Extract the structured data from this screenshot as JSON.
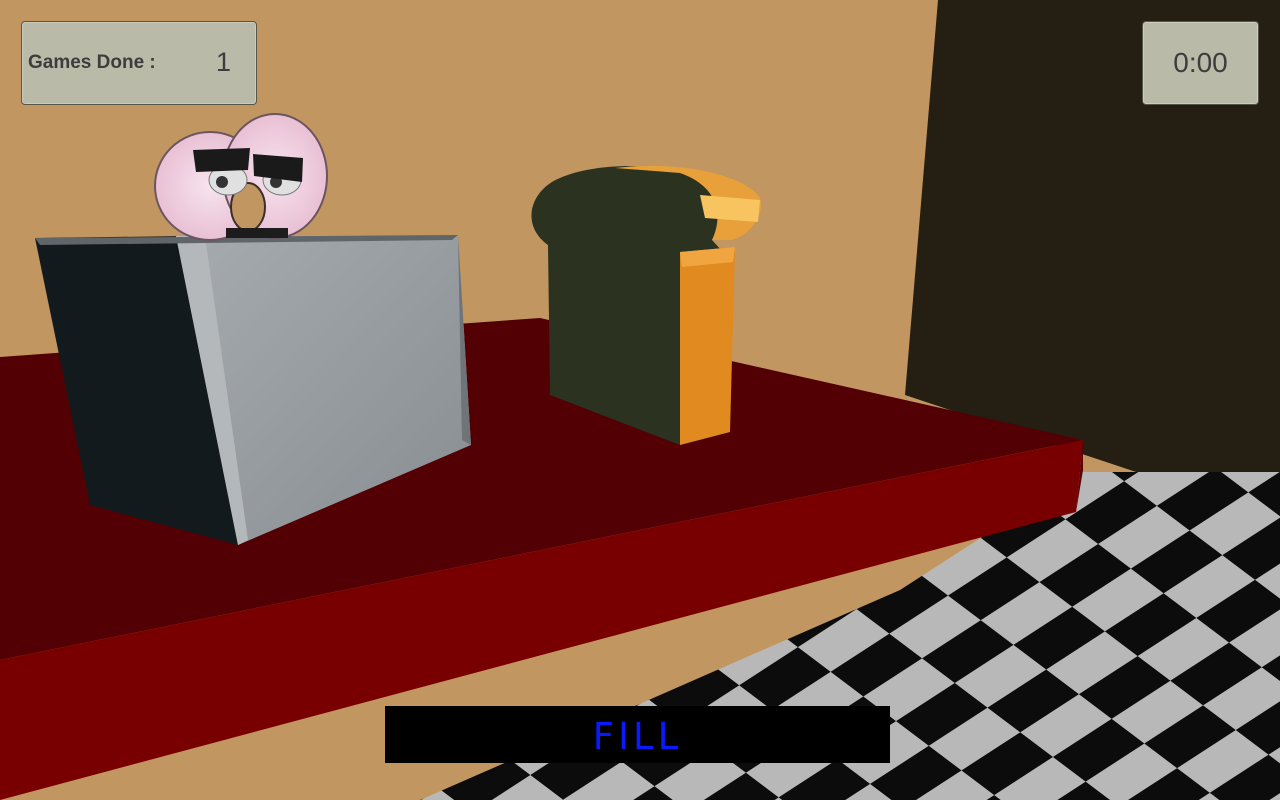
{
  "hud": {
    "games_done_label": "Games Done :",
    "games_done_value": "1",
    "timer": "0:00"
  },
  "action_button": {
    "label": "FILL",
    "label_color": "#0a1aff",
    "background": "#000000"
  },
  "scene": {
    "objects": [
      "donut-character",
      "toaster",
      "bread-slice",
      "red-counter",
      "checkered-floor",
      "dark-doorway"
    ],
    "colors": {
      "wall": "#c29660",
      "doorway": "#251e12",
      "counter_top": "#520003",
      "counter_front": "#790000",
      "floor_light": "#b8b8b8",
      "floor_dark": "#0c0c0c",
      "toaster_front": "#969ca0",
      "toaster_side": "#131a1e",
      "bread_face": "#2b3220",
      "bread_crust": "#e08a20",
      "donut": "#f0cfe0"
    }
  }
}
